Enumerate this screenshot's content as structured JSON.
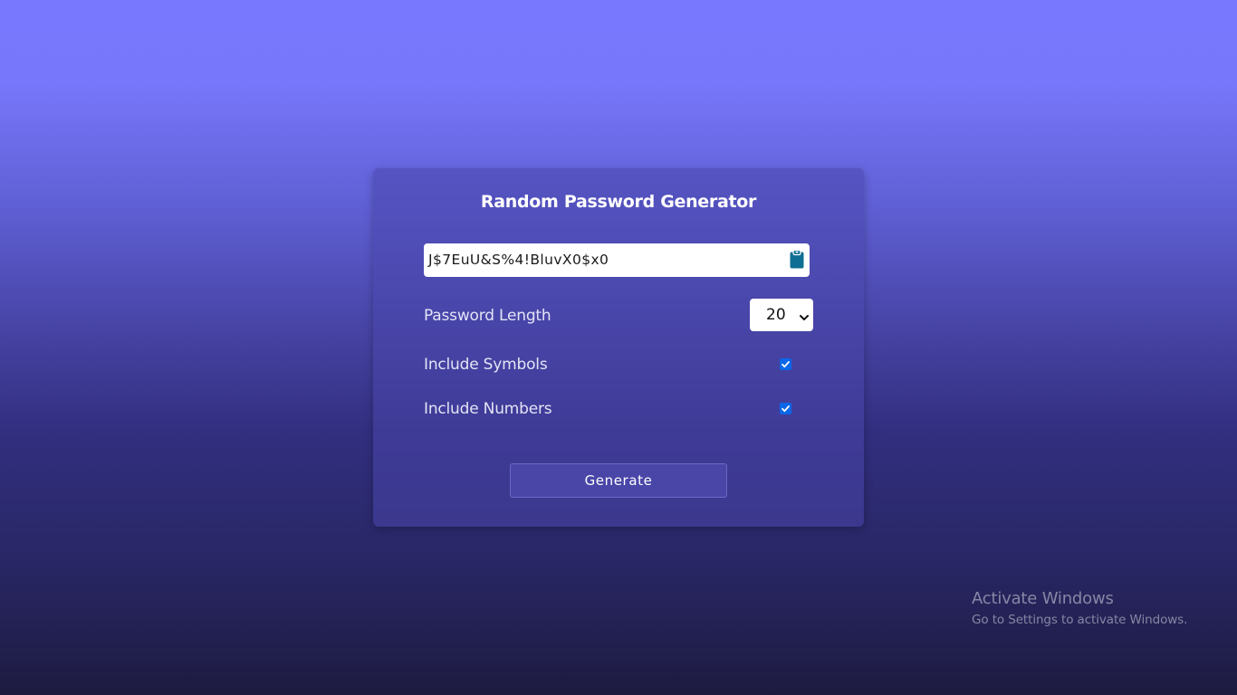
{
  "app": {
    "title": "Random Password Generator"
  },
  "password": {
    "value": "J$7EuU&S%4!BluvX0$x0",
    "copy_icon": "clipboard-icon"
  },
  "options": {
    "length_label": "Password Length",
    "length_value": "20",
    "symbols_label": "Include Symbols",
    "symbols_checked": true,
    "numbers_label": "Include Numbers",
    "numbers_checked": true
  },
  "actions": {
    "generate_label": "Generate"
  },
  "watermark": {
    "title": "Activate Windows",
    "subtitle": "Go to Settings to activate Windows."
  },
  "colors": {
    "background_top": "#7878ff",
    "background_bottom": "#1d1b40",
    "checkbox_accent": "#0b66e8",
    "clipboard_icon": "#0f6e93"
  }
}
